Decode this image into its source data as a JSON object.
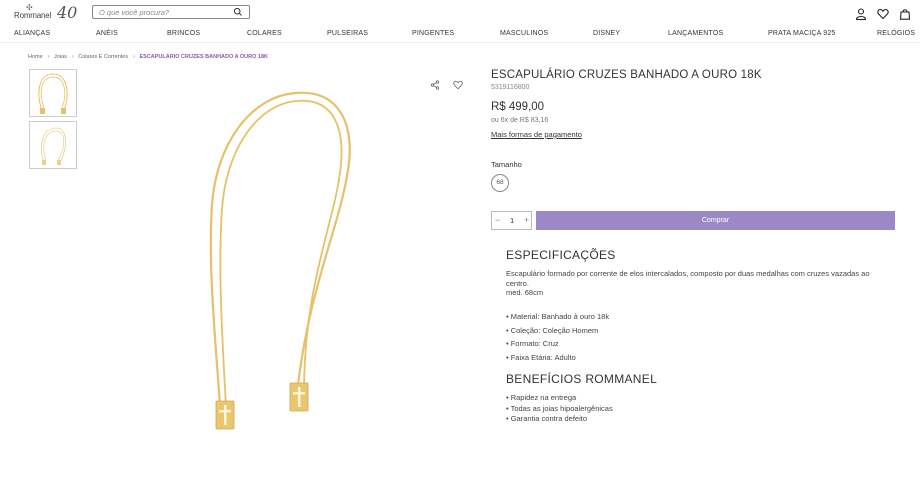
{
  "header": {
    "logo_text": "Rommanel",
    "logo_mark": "40",
    "search_placeholder": "O que você procura?",
    "icons": [
      "user-icon",
      "heart-icon",
      "bag-icon"
    ]
  },
  "nav": [
    "ALIANÇAS",
    "ANÉIS",
    "BRINCOS",
    "COLARES",
    "PULSEIRAS",
    "PINGENTES",
    "MASCULINOS",
    "DISNEY",
    "LANÇAMENTOS",
    "PRATA MACIÇA 925",
    "RELÓGIOS"
  ],
  "breadcrumb": [
    "Home",
    "Joias",
    "Colares E Correntes",
    "ESCAPULÁRIO CRUZES BANHADO A OURO 18K"
  ],
  "product": {
    "title": "ESCAPULÁRIO CRUZES BANHADO A OURO 18K",
    "sku": "5319116800",
    "price": "R$ 499,00",
    "installments": "ou 6x de R$ 83,16",
    "more_payment": "Mais formas de pagamento",
    "size_label": "Tamanho",
    "size_option": "68",
    "quantity": "1",
    "qty_minus": "−",
    "qty_plus": "+",
    "buy_label": "Comprar"
  },
  "specs": {
    "heading": "ESPECIFICAÇÕES",
    "description": "Escapulário formado por corrente de elos intercalados, composto por duas medalhas com cruzes vazadas ao centro.",
    "measure": "med. 68cm",
    "items": [
      "• Material: Banhado à ouro 18k",
      "• Coleção: Coleção Homem",
      "• Formato: Cruz",
      "• Faixa Etária: Adulto"
    ]
  },
  "benefits": {
    "heading": "BENEFÍCIOS ROMMANEL",
    "items": [
      "• Rapidez na entrega",
      "• Todas as joias hipoalergênicas",
      "• Garantia contra defeito"
    ]
  },
  "colors": {
    "accent": "#9b88c4",
    "gold": "#e6c169",
    "breadcrumb_current": "#8a5aa6"
  }
}
